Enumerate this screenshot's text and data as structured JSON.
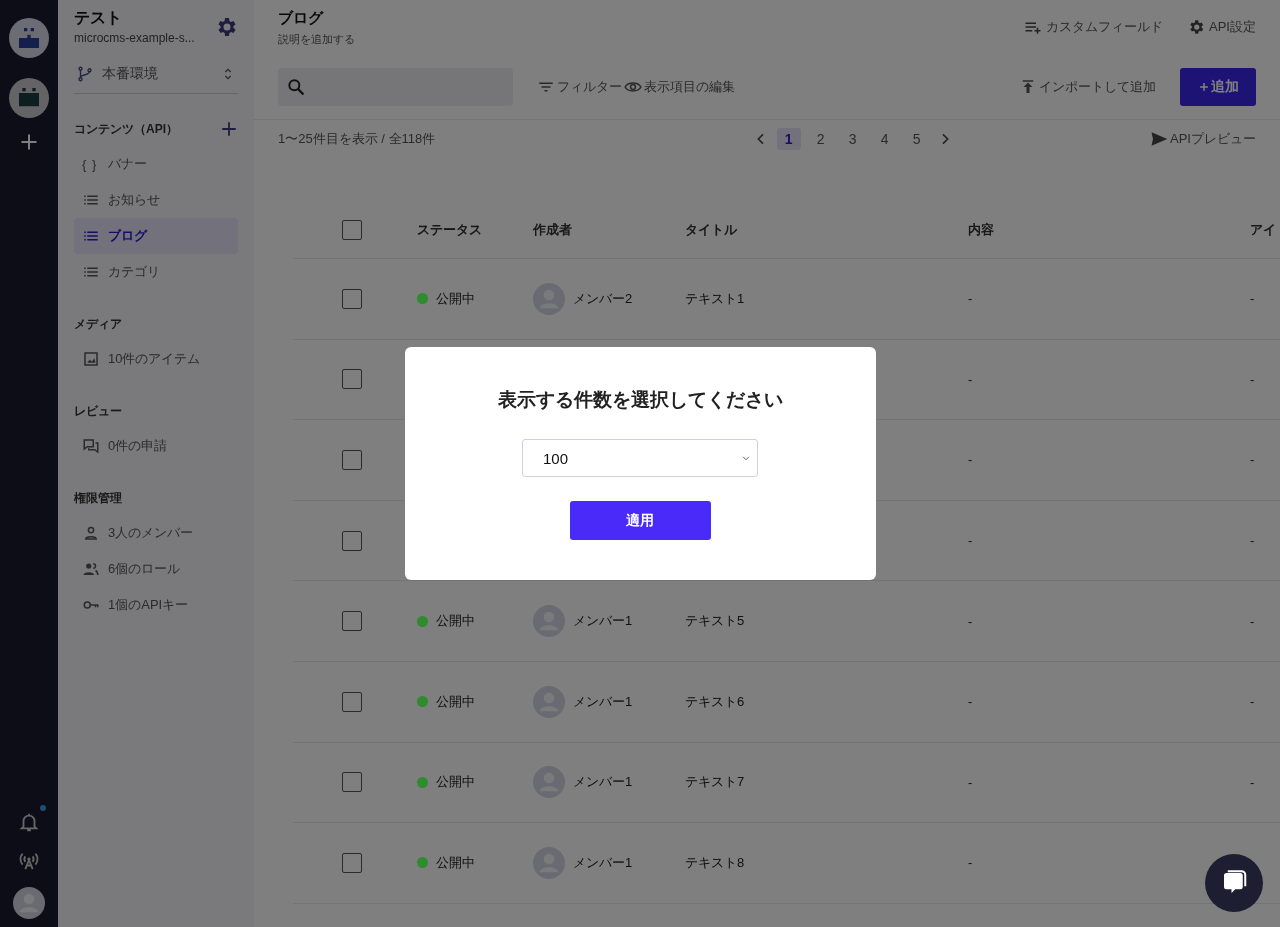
{
  "sidebar": {
    "project_name": "テスト",
    "project_id": "microcms-example-s...",
    "environment": "本番環境",
    "sections": [
      {
        "title": "コンテンツ（API）",
        "addable": true,
        "items": [
          {
            "label": "バナー",
            "kind": "object",
            "glyph": "{ }",
            "selected": false
          },
          {
            "label": "お知らせ",
            "kind": "list",
            "selected": false
          },
          {
            "label": "ブログ",
            "kind": "list",
            "selected": true
          },
          {
            "label": "カテゴリ",
            "kind": "list",
            "selected": false
          }
        ]
      },
      {
        "title": "メディア",
        "addable": false,
        "items": [
          {
            "label": "10件のアイテム",
            "kind": "media",
            "selected": false
          }
        ]
      },
      {
        "title": "レビュー",
        "addable": false,
        "items": [
          {
            "label": "0件の申請",
            "kind": "review",
            "selected": false
          }
        ]
      },
      {
        "title": "権限管理",
        "addable": false,
        "items": [
          {
            "label": "3人のメンバー",
            "kind": "member",
            "selected": false
          },
          {
            "label": "6個のロール",
            "kind": "role",
            "selected": false
          },
          {
            "label": "1個のAPIキー",
            "kind": "apikey",
            "selected": false
          }
        ]
      }
    ]
  },
  "rail": {
    "notification_unread": true
  },
  "header": {
    "title": "ブログ",
    "subtitle": "説明を追加する",
    "actions": [
      {
        "label": "カスタムフィールド",
        "kind": "fields"
      },
      {
        "label": "API設定",
        "kind": "settings"
      }
    ]
  },
  "toolbar": {
    "filter": "フィルター",
    "edit_columns": "表示項目の編集",
    "import": "インポートして追加",
    "add": "＋追加"
  },
  "pagination": {
    "summary": "1〜25件目を表示 / 全118件",
    "pages": [
      {
        "label": "1",
        "selected": true
      },
      {
        "label": "2",
        "selected": false
      },
      {
        "label": "3",
        "selected": false
      },
      {
        "label": "4",
        "selected": false
      },
      {
        "label": "5",
        "selected": false
      }
    ],
    "api_preview": "APIプレビュー"
  },
  "table": {
    "select_all_checked": false,
    "columns": [
      "ステータス",
      "作成者",
      "タイトル",
      "内容",
      "アイ"
    ],
    "rows": [
      {
        "checked": false,
        "status": "公開中",
        "color": "#2e8b2e",
        "author": "メンバー2",
        "title": "テキスト1",
        "content": "-",
        "column_6": "-"
      },
      {
        "checked": false,
        "content": "-",
        "column_6": "-"
      },
      {
        "checked": false,
        "content": "-",
        "column_6": "-"
      },
      {
        "checked": false,
        "content": "-",
        "column_6": "-"
      },
      {
        "checked": false,
        "status": "公開中",
        "color": "#2e8b2e",
        "author": "メンバー1",
        "title": "テキスト5",
        "content": "-",
        "column_6": "-"
      },
      {
        "checked": false,
        "status": "公開中",
        "color": "#2e8b2e",
        "author": "メンバー1",
        "title": "テキスト6",
        "content": "-",
        "column_6": "-"
      },
      {
        "checked": false,
        "status": "公開中",
        "color": "#2e8b2e",
        "author": "メンバー1",
        "title": "テキスト7",
        "content": "-",
        "column_6": "-"
      },
      {
        "checked": false,
        "status": "公開中",
        "color": "#2e8b2e",
        "author": "メンバー1",
        "title": "テキスト8",
        "content": "-"
      }
    ]
  },
  "modal": {
    "title": "表示する件数を選択してください",
    "select_value": "100",
    "apply": "適用"
  }
}
